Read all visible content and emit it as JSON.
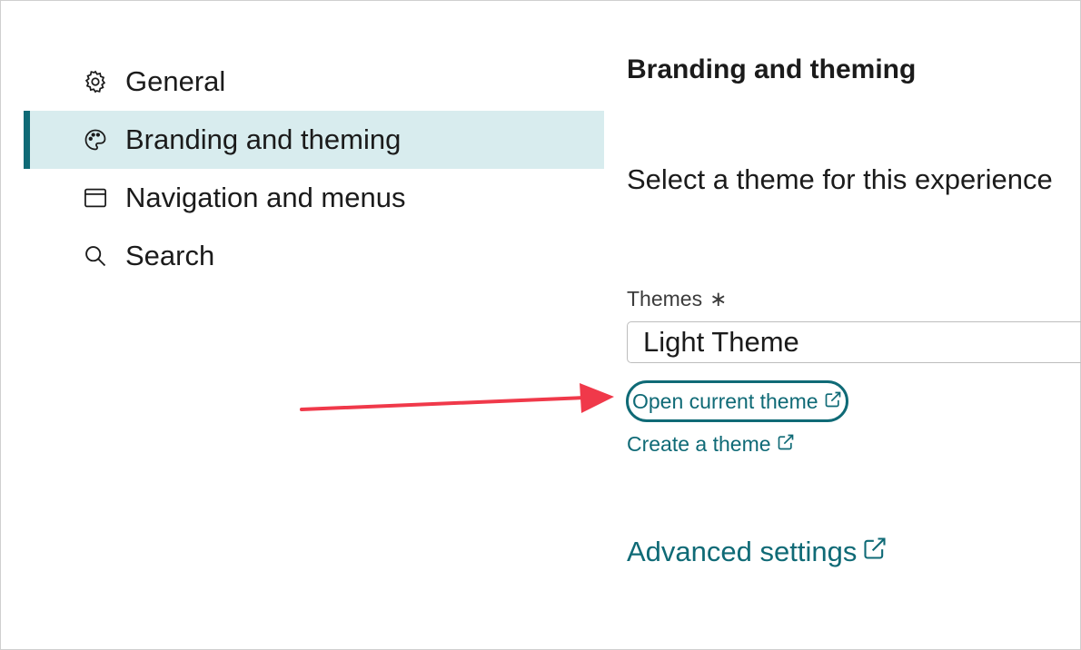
{
  "sidebar": {
    "items": [
      {
        "label": "General",
        "icon": "gear-icon",
        "active": false
      },
      {
        "label": "Branding and theming",
        "icon": "palette-icon",
        "active": true
      },
      {
        "label": "Navigation and menus",
        "icon": "window-icon",
        "active": false
      },
      {
        "label": "Search",
        "icon": "search-icon",
        "active": false
      }
    ]
  },
  "main": {
    "title": "Branding and theming",
    "description": "Select a theme for this experience",
    "themes_field": {
      "label": "Themes",
      "required_marker": "∗",
      "value": "Light Theme"
    },
    "links": {
      "open_current_theme": "Open current theme",
      "create_theme": "Create a theme",
      "advanced_settings": "Advanced settings"
    }
  },
  "colors": {
    "accent": "#0f6a76",
    "active_bg": "#d8ecee",
    "annotation_arrow": "#f0394a"
  }
}
